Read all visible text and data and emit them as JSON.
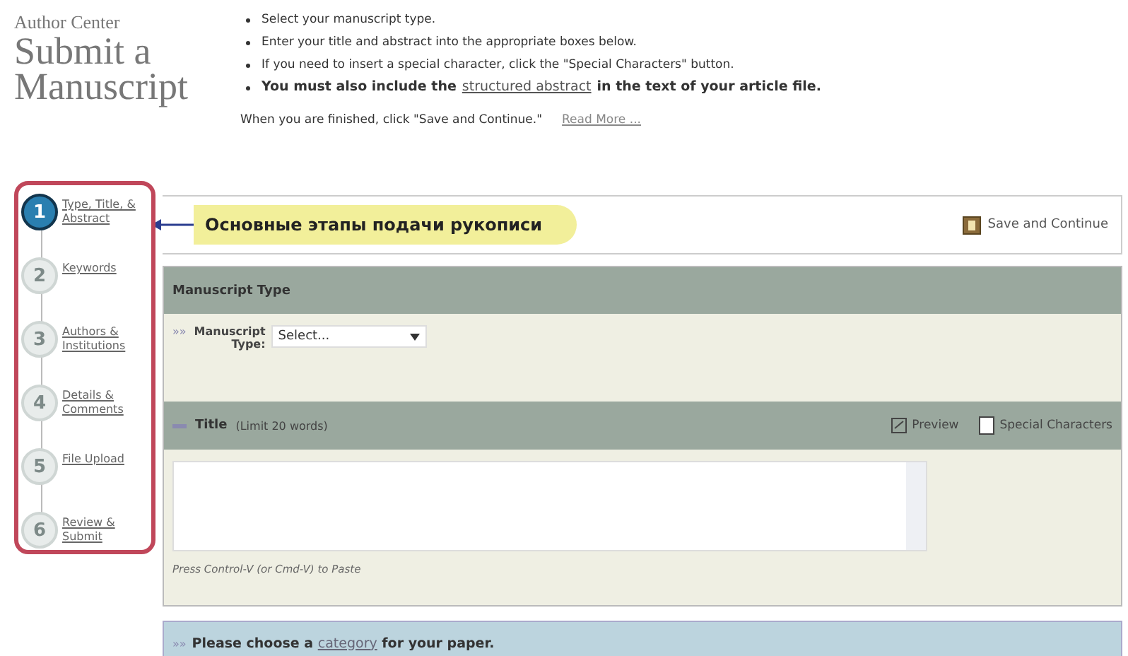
{
  "header": {
    "kicker": "Author Center",
    "title": "Submit a Manuscript"
  },
  "instructions": [
    {
      "text": "Select your manuscript type.",
      "bold": false
    },
    {
      "text": "Enter your title and abstract into the appropriate boxes below.",
      "bold": false
    },
    {
      "text": "If you need to insert a special character, click the \"Special Characters\" button.",
      "bold": false
    },
    {
      "text": "You must also include the",
      "link": "structured abstract",
      "text_after": "in the text of your article file.",
      "bold": true
    }
  ],
  "finish_note": {
    "text": "When you are finished, click \"Save and Continue.\"",
    "link": "Read More ..."
  },
  "steps": [
    {
      "number": "1",
      "label": "Type, Title, & Abstract",
      "selected": true
    },
    {
      "number": "2",
      "label": "Keywords",
      "selected": false
    },
    {
      "number": "3",
      "label": "Authors & Institutions",
      "selected": false
    },
    {
      "number": "4",
      "label": "Details & Comments",
      "selected": false
    },
    {
      "number": "5",
      "label": "File Upload",
      "selected": false
    },
    {
      "number": "6",
      "label": "Review & Submit",
      "selected": false
    }
  ],
  "callout": "Основные этапы подачи рукописи",
  "save_button": "Save and Continue",
  "manuscript_type": {
    "heading": "Manuscript Type",
    "marker": "»»",
    "label": "Manuscript Type:",
    "select": "Select..."
  },
  "title_section": {
    "heading": "Title",
    "limit": "(Limit 20 words)",
    "preview": "Preview",
    "special": "Special Characters",
    "hint": "Press Control-V (or Cmd-V) to Paste"
  },
  "category_bar": {
    "marker": "»»",
    "text": "Please choose a",
    "link": "category",
    "text_after": "for your paper."
  }
}
